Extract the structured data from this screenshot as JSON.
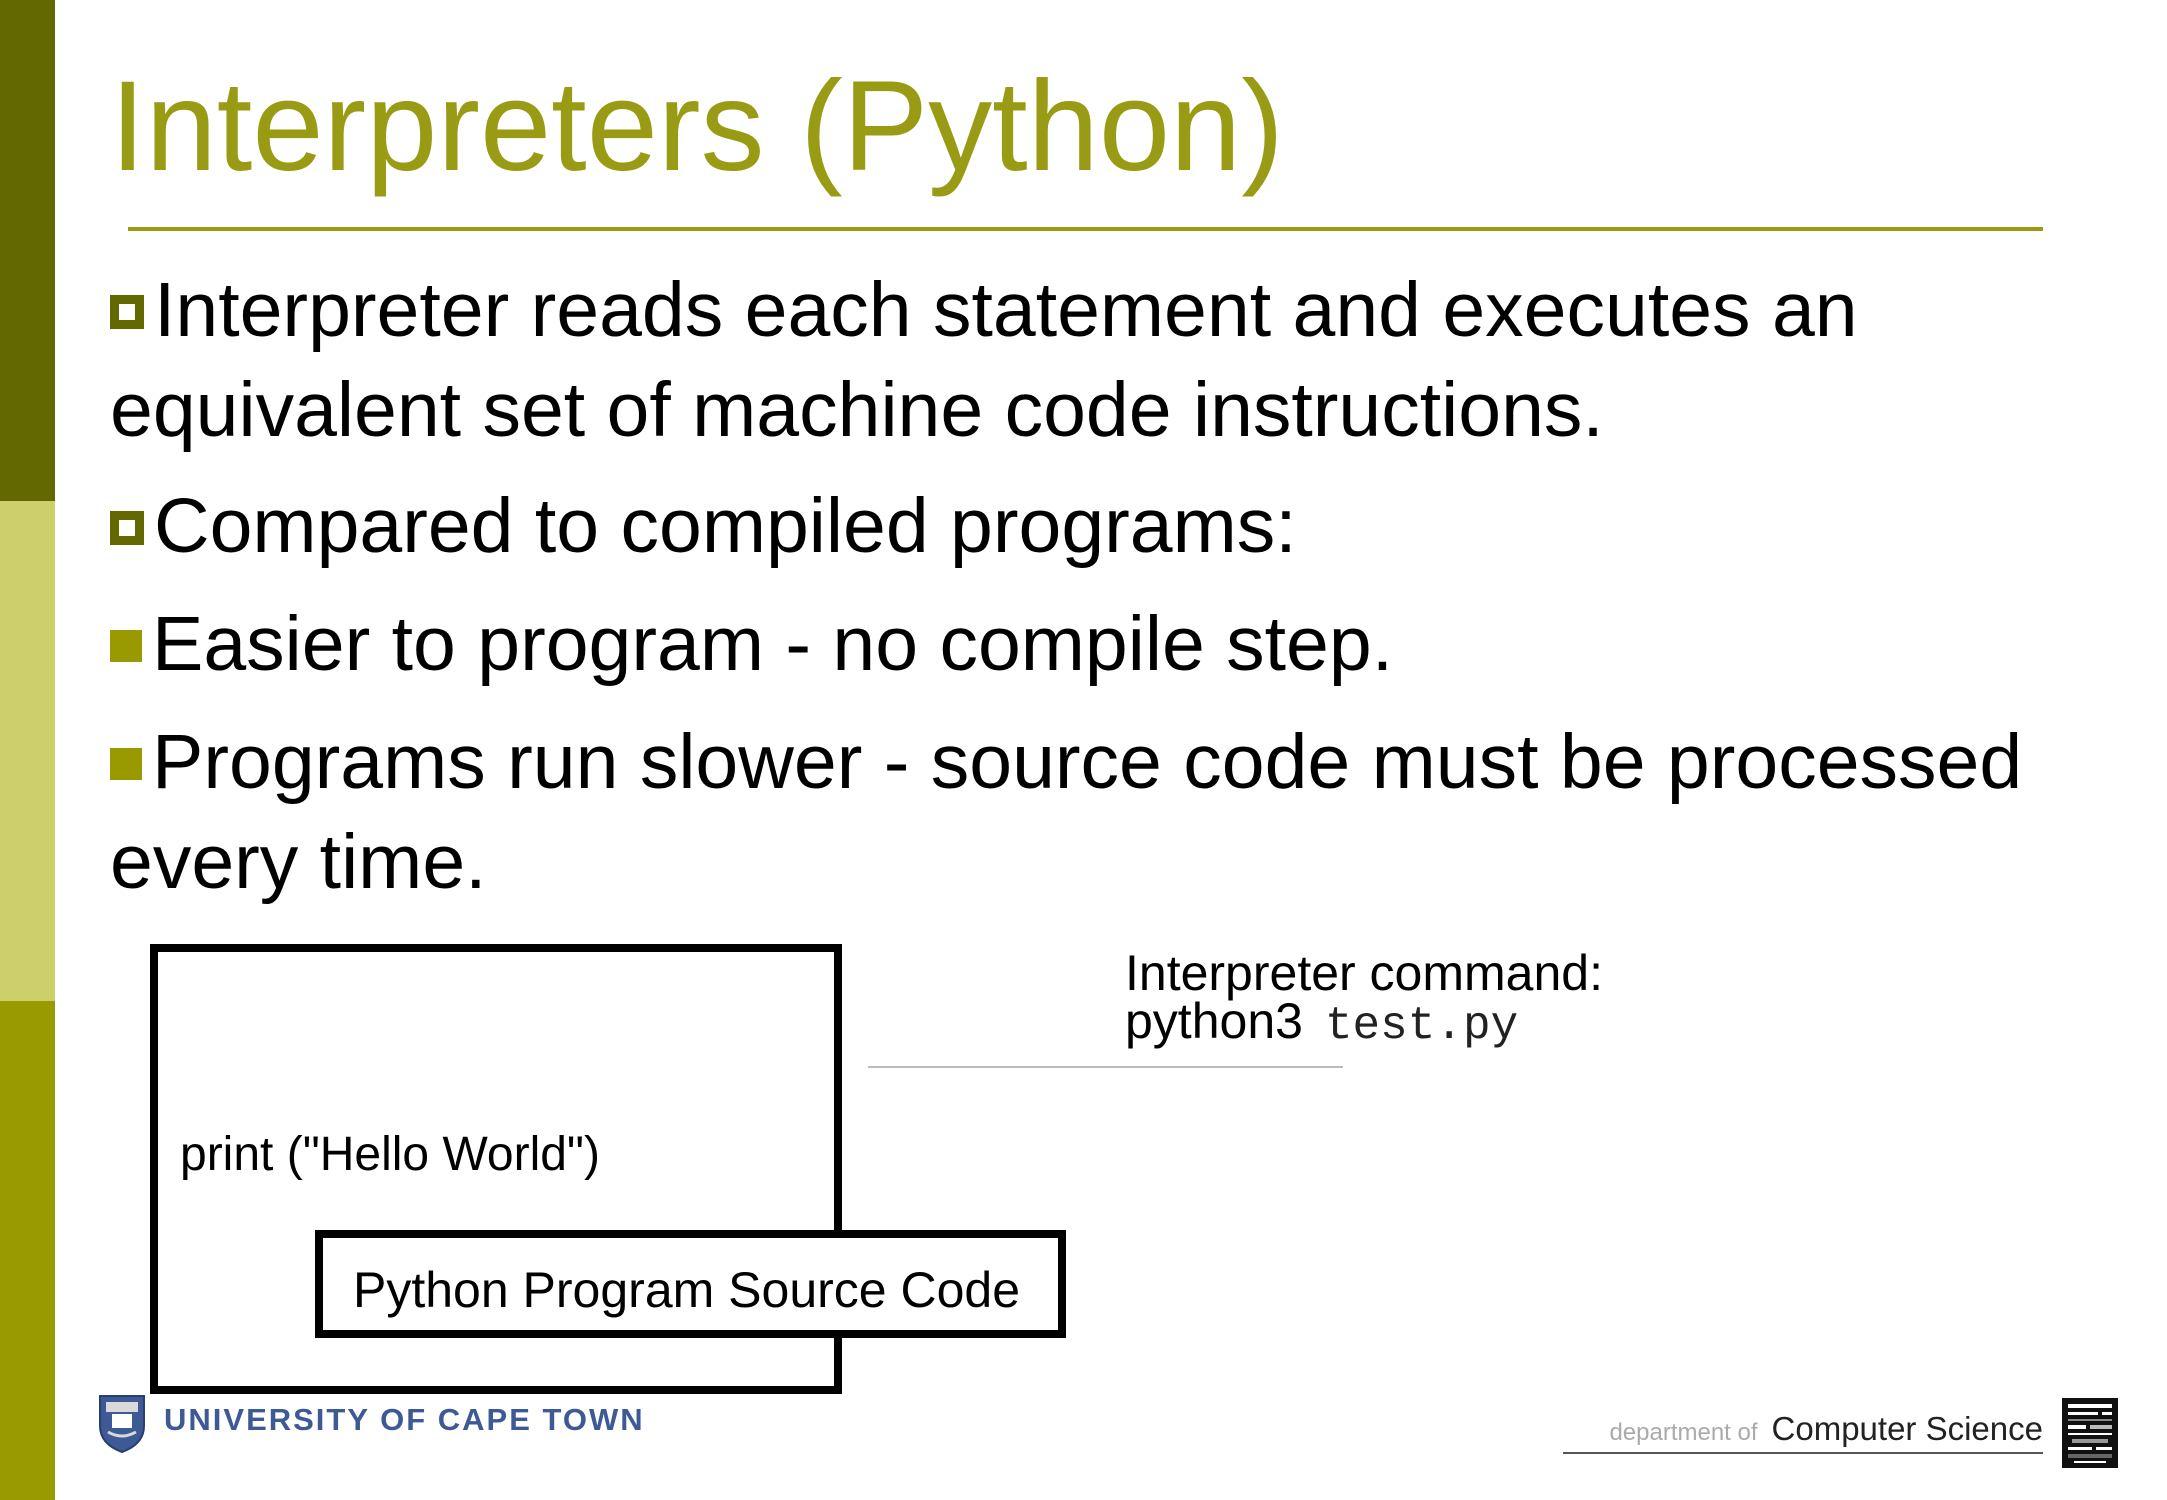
{
  "slide": {
    "title": "Interpreters (Python)",
    "bullets": [
      {
        "line1": "Interpreter reads each statement and executes an",
        "line2": "equivalent set of machine code instructions."
      },
      {
        "line1": "Compared to compiled programs:"
      },
      {
        "line1": "Easier to program - no compile step."
      },
      {
        "line1": "Programs run slower - source code must be processed",
        "line2": "every time."
      }
    ]
  },
  "diagram": {
    "source_code": "print (\"Hello World\")",
    "source_label": "Python Program Source Code",
    "command_caption": "Interpreter command:",
    "command_name": "python3",
    "command_arg": "test.py"
  },
  "footer": {
    "university": "UNIVERSITY OF CAPE TOWN",
    "dept_prefix": "department of",
    "dept_name": "Computer Science"
  },
  "colors": {
    "accent": "#9a9b14",
    "sidebar_dark": "#636800",
    "sidebar_light": "#cccf6a",
    "sidebar_mid": "#999900",
    "university_blue": "#3d5a96"
  }
}
